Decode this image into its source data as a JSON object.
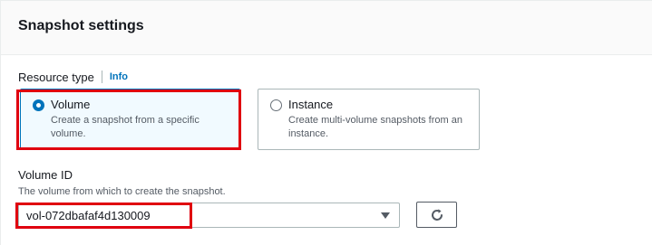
{
  "section": {
    "title": "Snapshot settings"
  },
  "resource_type": {
    "label": "Resource type",
    "info_label": "Info",
    "options": [
      {
        "title": "Volume",
        "description": "Create a snapshot from a specific volume.",
        "selected": true
      },
      {
        "title": "Instance",
        "description": "Create multi-volume snapshots from an instance.",
        "selected": false
      }
    ]
  },
  "volume_id": {
    "label": "Volume ID",
    "description": "The volume from which to create the snapshot.",
    "selected_value": "vol-072dbafaf4d130009"
  },
  "icons": {
    "select_caret": "caret-down-icon",
    "refresh": "refresh-icon"
  },
  "colors": {
    "accent": "#0073bb",
    "highlight": "#e0000f",
    "selected_tile_bg": "#f1faff"
  }
}
